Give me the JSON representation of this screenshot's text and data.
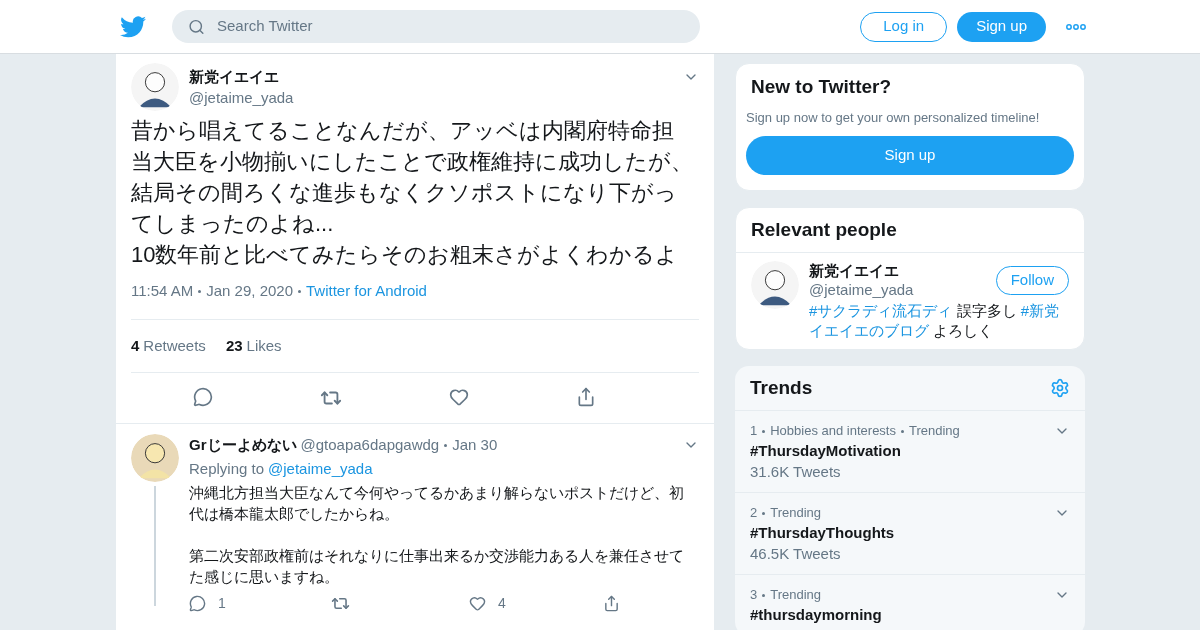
{
  "header": {
    "search": {
      "placeholder": "Search Twitter"
    },
    "buttons": [
      {
        "label": "Log in",
        "kind": "outline"
      },
      {
        "label": "Sign up",
        "kind": "filled"
      }
    ]
  },
  "tweet": {
    "name": "新党イエイエ",
    "handle": "@jetaime_yada",
    "text": "昔から唱えてることなんだが、アッベは内閣府特命担当大臣を小物揃いにしたことで政権維持に成功したが、結局その間ろくな進歩もなくクソポストになり下がってしまったのよね...\n10数年前と比べてみたらそのお粗末さがよくわかるよ",
    "time": "11:54 AM",
    "date": "Jan 29, 2020",
    "source": "Twitter for Android",
    "stats": [
      {
        "count": "4",
        "label": "Retweets"
      },
      {
        "count": "23",
        "label": "Likes"
      }
    ]
  },
  "reply": {
    "name": "Grじーよめない",
    "handle": "@gtoapa6dapgawdg",
    "date": "Jan 30",
    "replying_label": "Replying to",
    "replying_to": "@jetaime_yada",
    "paragraphs": [
      "沖縄北方担当大臣なんて今何やってるかあまり解らないポストだけど、初代は橋本龍太郎でしたからね。",
      "第二次安部政権前はそれなりに仕事出来るか交渉能力ある人を兼任させてた感じに思いますね。"
    ],
    "reply_count": "1",
    "like_count": "4"
  },
  "new_to_twitter": {
    "title": "New to Twitter?",
    "text": "Sign up now to get your own personalized timeline!",
    "button": "Sign up"
  },
  "relevant_people": {
    "title": "Relevant people",
    "person": {
      "name": "新党イエイエ",
      "handle": "@jetaime_yada",
      "button": "Follow",
      "bio": [
        {
          "text": "#サクラディ流石ディ",
          "link": true
        },
        {
          "text": "誤字多し",
          "link": false
        },
        {
          "text": "#新党イエイエのブログ",
          "link": true
        },
        {
          "text": "よろしく",
          "link": false
        }
      ]
    }
  },
  "trends": {
    "title": "Trends",
    "items": [
      {
        "rank": "1",
        "meta": [
          "Hobbies and interests",
          "Trending"
        ],
        "tag": "#ThursdayMotivation",
        "count": "31.6K Tweets"
      },
      {
        "rank": "2",
        "meta": [
          "Trending"
        ],
        "tag": "#ThursdayThoughts",
        "count": "46.5K Tweets"
      },
      {
        "rank": "3",
        "meta": [
          "Trending"
        ],
        "tag": "#thursdaymorning"
      }
    ]
  }
}
